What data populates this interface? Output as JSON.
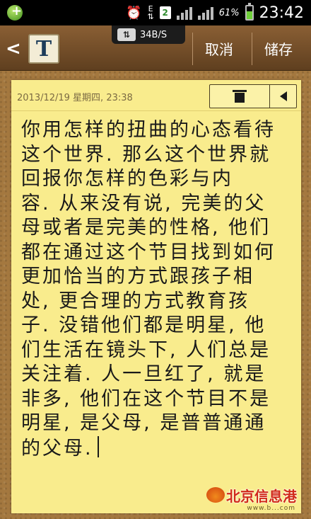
{
  "status_bar": {
    "network_type": "E",
    "notification_count": "2",
    "battery_percent": "61%",
    "battery_level": 0.61,
    "time": "23:42"
  },
  "action_bar": {
    "back_icon": "back-arrow-icon",
    "app_icon_letter": "T",
    "net_speed": "34B/S",
    "cancel_label": "取消",
    "save_label": "储存"
  },
  "note": {
    "date": "2013/12/19 星期四, 23:38",
    "lines": [
      "你用怎样的扭曲的心态看待",
      "这个世界. 那么这个世界就",
      "回报你怎样的色彩与内",
      "容. 从来没有说, 完美的父",
      "母或者是完美的性格, 他们",
      "都在通过这个节目找到如何",
      "更加恰当的方式跟孩子相",
      "处, 更合理的方式教育孩",
      "子. 没错他们都是明星, 他",
      "们生活在镜头下, 人们总是",
      "关注着. 人一旦红了, 就是",
      "非多, 他们在这个节目不是",
      "明星, 是父母, 是普普通通",
      "的父母."
    ]
  },
  "watermark": {
    "text": "北京信息港",
    "url": "www.b...com"
  },
  "colors": {
    "paper": "#f9ec8d",
    "cork": "#a4783f",
    "action_bar": "#7a522b"
  }
}
